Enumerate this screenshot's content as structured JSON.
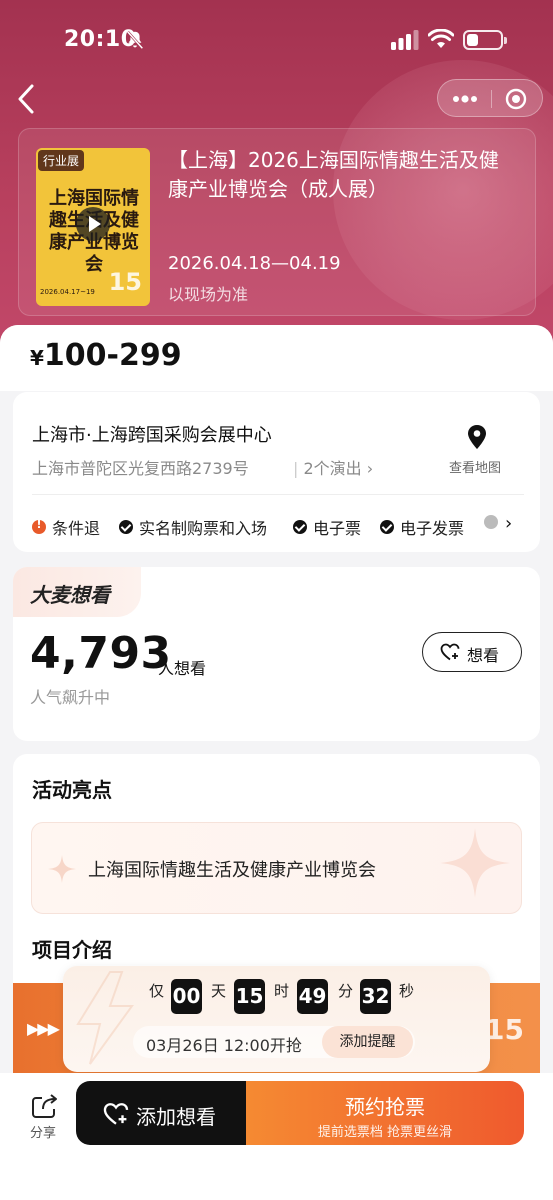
{
  "status_bar": {
    "time": "20:10"
  },
  "show": {
    "poster_tag": "行业展",
    "poster_title": "上海国际情趣生活及健康产业博览会",
    "poster_date": "2026.04.17~19",
    "poster_badge": "15",
    "title": "【上海】2026上海国际情趣生活及健康产业博览会（成人展）",
    "date": "2026.04.18—04.19",
    "date_note": "以现场为准"
  },
  "price": {
    "currency": "¥",
    "range": "100-299"
  },
  "venue": {
    "name": "上海市·上海跨国采购会展中心",
    "address": "上海市普陀区光复西路2739号",
    "shows": "2个演出",
    "map_label": "查看地图"
  },
  "policies": [
    {
      "label": "条件退",
      "icon": "orange-alert"
    },
    {
      "label": "实名制购票和入场",
      "icon": "black-check"
    },
    {
      "label": "电子票",
      "icon": "black-check"
    },
    {
      "label": "电子发票",
      "icon": "black-check"
    }
  ],
  "want": {
    "badge": "大麦想看",
    "count": "4,793",
    "unit": "人想看",
    "trend": "人气飙升中",
    "button": "想看"
  },
  "highlights": {
    "title": "活动亮点",
    "text": "上海国际情趣生活及健康产业博览会"
  },
  "intro": {
    "title": "项目介绍",
    "badge": "15"
  },
  "countdown": {
    "prefix": "仅",
    "days": "00",
    "days_unit": "天",
    "hours": "15",
    "hours_unit": "时",
    "minutes": "49",
    "minutes_unit": "分",
    "seconds": "32",
    "seconds_unit": "秒",
    "sale_time": "03月26日 12:00开抢",
    "remind_button": "添加提醒"
  },
  "bottom": {
    "share": "分享",
    "want_button": "添加想看",
    "buy_button": "预约抢票",
    "buy_sub": "提前选票档 抢票更丝滑"
  },
  "colors": {
    "hero": "#b8405e",
    "accent": "#ef5a2e",
    "dark": "#111111"
  }
}
